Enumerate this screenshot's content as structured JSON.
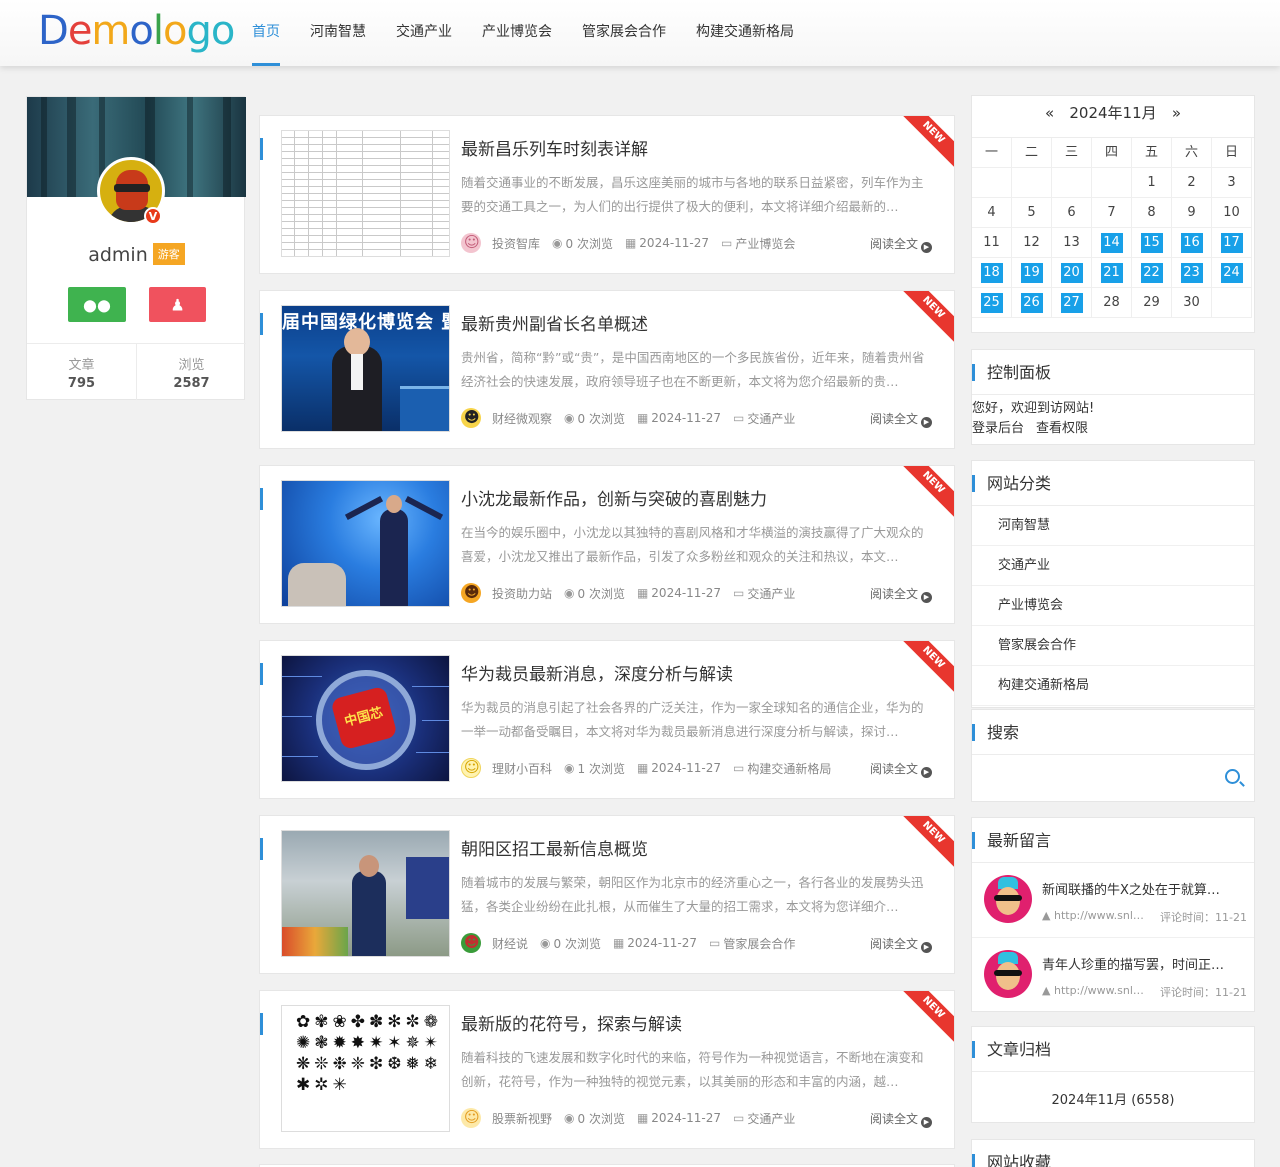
{
  "header": {
    "logo": [
      "D",
      "e",
      "m",
      "o",
      "l",
      "o",
      "g",
      "o"
    ],
    "nav": [
      "首页",
      "河南智慧",
      "交通产业",
      "产业博览会",
      "管家展会合作",
      "构建交通新格局"
    ]
  },
  "user": {
    "name": "admin",
    "role": "游客",
    "badge": "V",
    "stats": [
      {
        "label": "文章",
        "value": "795"
      },
      {
        "label": "浏览",
        "value": "2587"
      }
    ]
  },
  "articles": [
    {
      "title": "最新昌乐列车时刻表详解",
      "desc": "随着交通事业的不断发展，昌乐这座美丽的城市与各地的联系日益紧密，列车作为主要的交通工具之一，为人们的出行提供了极大的便利，本文将详细介绍最新的…",
      "author": "投资智库",
      "views": "0 次浏览",
      "date": "2024-11-27",
      "category": "产业博览会",
      "readmore": "阅读全文",
      "ribbon": "NEW"
    },
    {
      "title": "最新贵州副省长名单概述",
      "desc": "贵州省，简称“黔”或“贵”，是中国西南地区的一个多民族省份，近年来，随着贵州省经济社会的快速发展，政府领导班子也在不断更新，本文将为您介绍最新的贵…",
      "author": "财经微观察",
      "views": "0 次浏览",
      "date": "2024-11-27",
      "category": "交通产业",
      "readmore": "阅读全文",
      "ribbon": "NEW",
      "thumb_text": "届中国绿化博览会 暨会…"
    },
    {
      "title": "小沈龙最新作品，创新与突破的喜剧魅力",
      "desc": "在当今的娱乐圈中，小沈龙以其独特的喜剧风格和才华横溢的演技赢得了广大观众的喜爱，小沈龙又推出了最新作品，引发了众多粉丝和观众的关注和热议，本文…",
      "author": "投资助力站",
      "views": "0 次浏览",
      "date": "2024-11-27",
      "category": "交通产业",
      "readmore": "阅读全文",
      "ribbon": "NEW"
    },
    {
      "title": "华为裁员最新消息，深度分析与解读",
      "desc": "华为裁员的消息引起了社会各界的广泛关注，作为一家全球知名的通信企业，华为的一举一动都备受瞩目，本文将对华为裁员最新消息进行深度分析与解读，探讨…",
      "author": "理财小百科",
      "views": "1 次浏览",
      "date": "2024-11-27",
      "category": "构建交通新格局",
      "readmore": "阅读全文",
      "ribbon": "NEW",
      "thumb_text": "中国芯"
    },
    {
      "title": "朝阳区招工最新信息概览",
      "desc": "随着城市的发展与繁荣，朝阳区作为北京市的经济重心之一，各行各业的发展势头迅猛，各类企业纷纷在此扎根，从而催生了大量的招工需求，本文将为您详细介…",
      "author": "财经说",
      "views": "0 次浏览",
      "date": "2024-11-27",
      "category": "管家展会合作",
      "readmore": "阅读全文",
      "ribbon": "NEW"
    },
    {
      "title": "最新版的花符号，探索与解读",
      "desc": "随着科技的飞速发展和数字化时代的来临，符号作为一种视觉语言，不断地在演变和创新，花符号，作为一种独特的视觉元素，以其美丽的形态和丰富的内涵，越…",
      "author": "股票新视野",
      "views": "0 次浏览",
      "date": "2024-11-27",
      "category": "交通产业",
      "readmore": "阅读全文",
      "ribbon": "NEW",
      "thumb_text": "✿✾❀✤✽✻✼❁✺❃✹✸✷✶✵✴❋❊❉❈❇❆❅❄✱✲✳"
    }
  ],
  "calendar": {
    "prev": "«",
    "next": "»",
    "month": "2024年11月",
    "weekdays": [
      "一",
      "二",
      "三",
      "四",
      "五",
      "六",
      "日"
    ],
    "days": [
      "",
      "",
      "",
      "",
      "1",
      "2",
      "3",
      "4",
      "5",
      "6",
      "7",
      "8",
      "9",
      "10",
      "11",
      "12",
      "13",
      "14",
      "15",
      "16",
      "17",
      "18",
      "19",
      "20",
      "21",
      "22",
      "23",
      "24",
      "25",
      "26",
      "27",
      "28",
      "29",
      "30",
      ""
    ],
    "highlighted": [
      "14",
      "15",
      "16",
      "17",
      "18",
      "19",
      "20",
      "21",
      "22",
      "23",
      "24",
      "25",
      "26",
      "27"
    ]
  },
  "panel": {
    "title": "控制面板",
    "welcome": "您好，欢迎到访网站!",
    "links": [
      "登录后台",
      "查看权限"
    ]
  },
  "categories": {
    "title": "网站分类",
    "items": [
      "河南智慧",
      "交通产业",
      "产业博览会",
      "管家展会合作",
      "构建交通新格局"
    ]
  },
  "search": {
    "title": "搜索",
    "placeholder": ""
  },
  "comments": {
    "title": "最新留言",
    "items": [
      {
        "text": "新闻联播的牛X之处在于就算…",
        "url": "http://www.snlan…",
        "time": "评论时间：11-21"
      },
      {
        "text": "青年人珍重的描写罢，时间正…",
        "url": "http://www.snlan…",
        "time": "评论时间：11-21"
      }
    ]
  },
  "archive": {
    "title": "文章归档",
    "items": [
      "2024年11月 (6558)"
    ]
  },
  "favorites": {
    "title": "网站收藏"
  },
  "colors": {
    "accent": "#2e8fd8",
    "calendar_highlight": "#18a0e8",
    "ribbon": "#e8362e",
    "wechat": "#3fb34f",
    "qq": "#f0525e",
    "role_badge": "#f5a623"
  }
}
